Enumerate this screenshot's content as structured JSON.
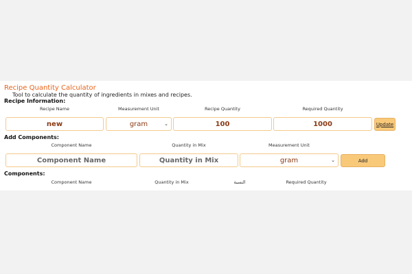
{
  "app": {
    "title": "Recipe Quantity Calculator",
    "description": "Tool to calculate the quantity of ingredients in mixes and recipes."
  },
  "recipe_info": {
    "heading": "Recipe Information:",
    "labels": {
      "name": "Recipe Name",
      "unit": "Measurement Unit",
      "quantity": "Recipe Quantity",
      "required": "Required Quantity"
    },
    "values": {
      "name": "new",
      "unit": "gram",
      "quantity": "100",
      "required": "1000"
    },
    "update_label": "Update"
  },
  "add_components": {
    "heading": "Add Components:",
    "labels": {
      "name": "Component Name",
      "quantity": "Quantity in Mix",
      "unit": "Measurement Unit"
    },
    "placeholders": {
      "name": "Component Name",
      "quantity": "Quantity in Mix"
    },
    "unit_value": "gram",
    "add_label": "Add"
  },
  "components": {
    "heading": "Components:",
    "columns": [
      "Component Name",
      "Quantity in Mix",
      "النسبة",
      "Required Quantity"
    ]
  }
}
